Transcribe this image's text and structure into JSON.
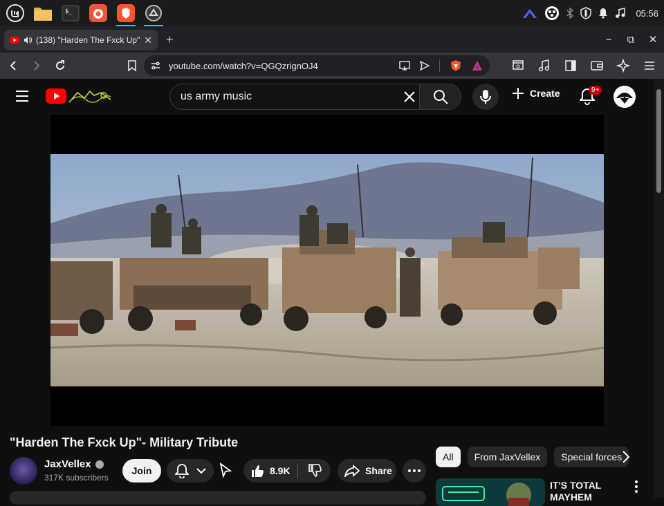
{
  "os": {
    "clock": "05:56",
    "apps": [
      {
        "name": "menu-icon"
      },
      {
        "name": "files-icon"
      },
      {
        "name": "terminal-icon"
      },
      {
        "name": "firefox-icon"
      },
      {
        "name": "brave-icon"
      },
      {
        "name": "obs-icon"
      }
    ]
  },
  "browser": {
    "tab_title": "(138) \"Harden The Fxck Up\"",
    "url": "youtube.com/watch?v=QGQzrignOJ4",
    "new_tab": "+",
    "controls": {
      "minimize": "−",
      "maximize": "⧉",
      "close": "✕"
    }
  },
  "youtube": {
    "search_value": "us army music",
    "create_label": "Create",
    "notification_count": "9+",
    "video": {
      "title": "\"Harden The Fxck Up\"- Military Tribute",
      "channel": "JaxVellex",
      "subscribers": "317K subscribers",
      "join_label": "Join",
      "likes": "8.9K",
      "share_label": "Share"
    },
    "chips": [
      "All",
      "From JaxVellex",
      "Special forces"
    ],
    "recommended": [
      {
        "title": "IT'S TOTAL MAYHEM"
      }
    ]
  },
  "colors": {
    "background": "#0f0f0f",
    "youtube_red": "#ff0000",
    "chip_active": "#f1f1f1",
    "badge": "#cc0000"
  }
}
